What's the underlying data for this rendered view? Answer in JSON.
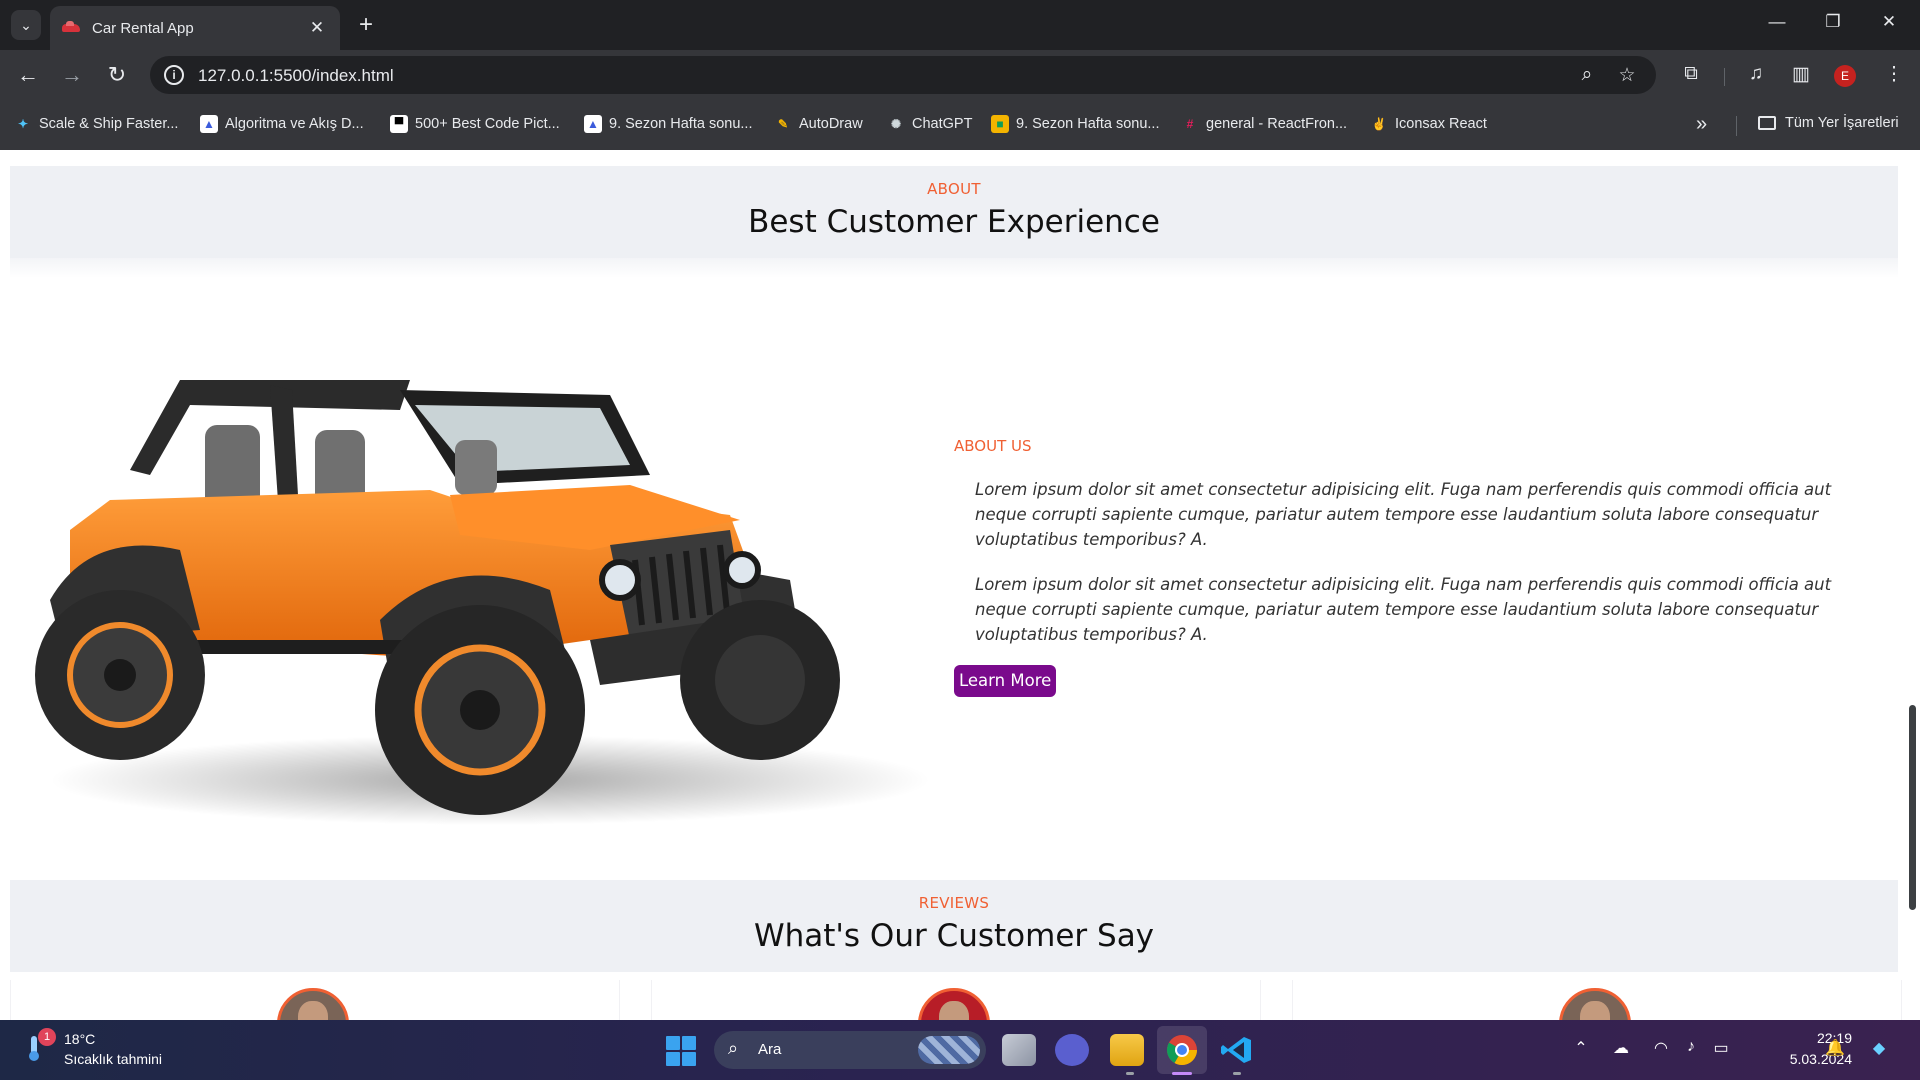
{
  "tab": {
    "title": "Car Rental App",
    "close": "✕"
  },
  "toolbar": {
    "url": "127.0.0.1:5500/index.html",
    "avatar_initial": "E"
  },
  "bookmarks": [
    {
      "label": "Scale & Ship Faster...",
      "icon": "sparkle-icon",
      "color": "#4fc3f7"
    },
    {
      "label": "Algoritma ve Akış D...",
      "icon": "doc-icon",
      "color": "#ffffff"
    },
    {
      "label": "500+ Best Code Pict...",
      "icon": "code-icon",
      "color": "#ffffff"
    },
    {
      "label": "9. Sezon Hafta sonu...",
      "icon": "doc-icon",
      "color": "#ffffff"
    },
    {
      "label": "AutoDraw",
      "icon": "pen-icon",
      "color": "#f4b400"
    },
    {
      "label": "ChatGPT",
      "icon": "chatgpt-icon",
      "color": "#10a37f"
    },
    {
      "label": "9. Sezon Hafta sonu...",
      "icon": "classroom-icon",
      "color": "#f4b400"
    },
    {
      "label": "general - ReactFron...",
      "icon": "slack-icon",
      "color": "#e01e5a"
    },
    {
      "label": "Iconsax React",
      "icon": "victory-hand-icon",
      "color": "#fbc02d"
    }
  ],
  "bookmarks_folder": "Tüm Yer İşaretleri",
  "page": {
    "about_band": {
      "kicker": "ABOUT",
      "title": "Best Customer Experience"
    },
    "about": {
      "kicker": "ABOUT US",
      "paragraph1": "Lorem ipsum dolor sit amet consectetur adipisicing elit. Fuga nam perferendis quis commodi officia aut neque corrupti sapiente cumque, pariatur autem tempore esse laudantium soluta labore consequatur voluptatibus temporibus? A.",
      "paragraph2": "Lorem ipsum dolor sit amet consectetur adipisicing elit. Fuga nam perferendis quis commodi officia aut neque corrupti sapiente cumque, pariatur autem tempore esse laudantium soluta labore consequatur voluptatibus temporibus? A.",
      "button": "Learn More"
    },
    "reviews_band": {
      "kicker": "REVIEWS",
      "title": "What's Our Customer Say"
    }
  },
  "taskbar": {
    "weather_temp": "18°C",
    "weather_desc": "Sıcaklık tahmini",
    "weather_badge": "1",
    "search_placeholder": "Ara",
    "time": "22:19",
    "date": "5.03.2024"
  },
  "colors": {
    "accent": "#f06033",
    "button": "#7a0a8c",
    "band": "#eef0f4"
  }
}
